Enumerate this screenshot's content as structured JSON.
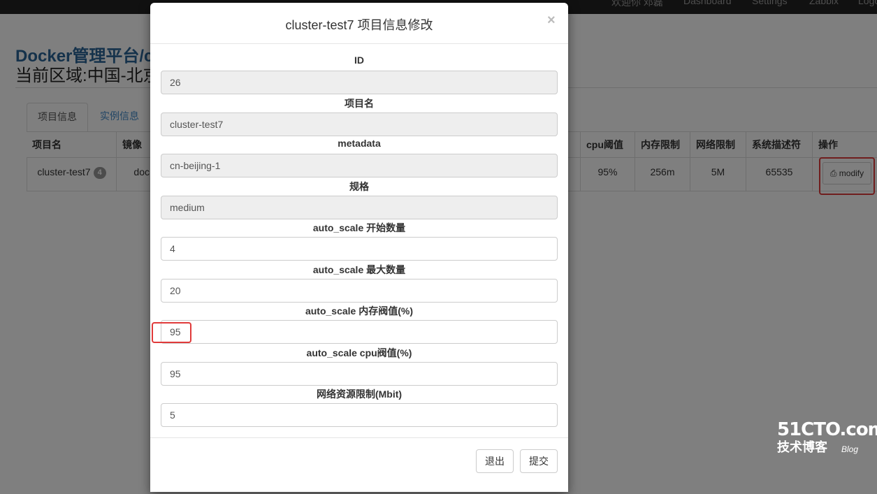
{
  "topnav": {
    "items": [
      "欢迎你 邓磊",
      "Dashboard",
      "Settings",
      "Zabbix",
      "Logout"
    ]
  },
  "page": {
    "brand": "Docker管理平台/c",
    "region": "当前区域:中国-北京"
  },
  "tabs": [
    {
      "label": "项目信息",
      "active": true
    },
    {
      "label": "实例信息",
      "active": false
    }
  ],
  "table": {
    "headers": [
      "项目名",
      "镜像",
      "cpu阈值",
      "内存限制",
      "网络限制",
      "系统描述符",
      "操作"
    ],
    "row": {
      "project": "cluster-test7",
      "badge": "4",
      "image": "doc",
      "cpu": "95%",
      "mem": "256m",
      "net": "5M",
      "fd": "65535",
      "action_label": "modify"
    }
  },
  "modal": {
    "title": "cluster-test7 项目信息修改",
    "close": "×",
    "fields": [
      {
        "label": "ID",
        "value": "26",
        "readonly": true
      },
      {
        "label": "项目名",
        "value": "cluster-test7",
        "readonly": true
      },
      {
        "label": "metadata",
        "value": "cn-beijing-1",
        "readonly": true
      },
      {
        "label": "规格",
        "value": "medium",
        "readonly": true
      },
      {
        "label": "auto_scale 开始数量",
        "value": "4",
        "readonly": false
      },
      {
        "label": "auto_scale 最大数量",
        "value": "20",
        "readonly": false
      },
      {
        "label": "auto_scale 内存阀值(%)",
        "value": "95",
        "readonly": false
      },
      {
        "label": "auto_scale cpu阀值(%)",
        "value": "95",
        "readonly": false
      },
      {
        "label": "网络资源限制(Mbit)",
        "value": "5",
        "readonly": false
      }
    ],
    "exit_label": "退出",
    "submit_label": "提交"
  },
  "watermark": {
    "line1": "51CTO.com",
    "line2": "技术博客",
    "line3": "Blog"
  },
  "colors": {
    "highlight": "#e03a3a",
    "link": "#428bca"
  }
}
